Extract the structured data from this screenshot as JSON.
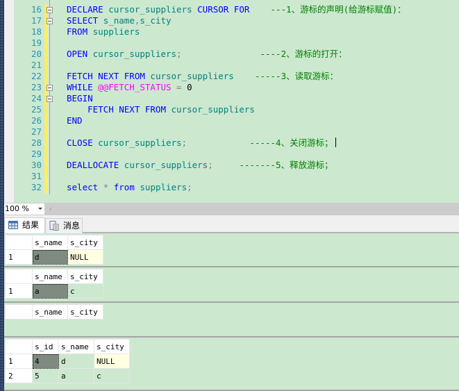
{
  "editor": {
    "lines": [
      {
        "num": "16",
        "fold": true,
        "segments": [
          [
            "kw",
            "DECLARE "
          ],
          [
            "id",
            "cursor_suppliers "
          ],
          [
            "kw",
            "CURSOR FOR"
          ],
          [
            "cm",
            "    ---1、游标的声明(给游标赋值)："
          ]
        ]
      },
      {
        "num": "17",
        "fold": true,
        "segments": [
          [
            "kw",
            "SELECT "
          ],
          [
            "id",
            "s_name"
          ],
          [
            "op",
            ","
          ],
          [
            "id",
            "s_city"
          ]
        ]
      },
      {
        "num": "18",
        "fold": false,
        "segments": [
          [
            "kw",
            "FROM "
          ],
          [
            "id",
            "suppliers"
          ]
        ]
      },
      {
        "num": "19",
        "fold": false,
        "segments": []
      },
      {
        "num": "20",
        "fold": false,
        "segments": [
          [
            "kw",
            "OPEN "
          ],
          [
            "id",
            "cursor_suppliers"
          ],
          [
            "op",
            ";"
          ],
          [
            "cm",
            "               ----2、游标的打开："
          ]
        ]
      },
      {
        "num": "21",
        "fold": false,
        "segments": []
      },
      {
        "num": "22",
        "fold": false,
        "segments": [
          [
            "kw",
            "FETCH NEXT FROM "
          ],
          [
            "id",
            "cursor_suppliers"
          ],
          [
            "cm",
            "    -----3、读取游标："
          ]
        ]
      },
      {
        "num": "23",
        "fold": true,
        "segments": [
          [
            "kw",
            "WHILE "
          ],
          [
            "sys",
            "@@FETCH_STATUS"
          ],
          [
            "op",
            " = "
          ],
          [
            "num",
            "0"
          ]
        ]
      },
      {
        "num": "24",
        "fold": true,
        "segments": [
          [
            "kw",
            "BEGIN"
          ]
        ]
      },
      {
        "num": "25",
        "fold": false,
        "segments": [
          [
            "kw",
            "    FETCH NEXT FROM "
          ],
          [
            "id",
            "cursor_suppliers"
          ]
        ]
      },
      {
        "num": "26",
        "fold": false,
        "segments": [
          [
            "kw",
            "END"
          ]
        ]
      },
      {
        "num": "27",
        "fold": false,
        "segments": []
      },
      {
        "num": "28",
        "fold": false,
        "caret": true,
        "segments": [
          [
            "kw",
            "CLOSE "
          ],
          [
            "id",
            "cursor_suppliers"
          ],
          [
            "op",
            ";"
          ],
          [
            "cm",
            "            -----4、关闭游标；"
          ]
        ]
      },
      {
        "num": "29",
        "fold": false,
        "segments": []
      },
      {
        "num": "30",
        "fold": false,
        "segments": [
          [
            "kw",
            "DEALLOCATE "
          ],
          [
            "id",
            "cursor_suppliers"
          ],
          [
            "op",
            ";"
          ],
          [
            "cm",
            "     -------5、释放游标；"
          ]
        ]
      },
      {
        "num": "31",
        "fold": false,
        "segments": []
      },
      {
        "num": "32",
        "fold": false,
        "segments": [
          [
            "kw",
            "select "
          ],
          [
            "op",
            "* "
          ],
          [
            "kw",
            "from "
          ],
          [
            "id",
            "suppliers"
          ],
          [
            "op",
            ";"
          ]
        ]
      }
    ]
  },
  "statusbar": {
    "zoom_value": "100 %",
    "scroll_left_glyph": "‹"
  },
  "tabs": [
    {
      "label": "结果",
      "icon": "grid-icon",
      "active": true
    },
    {
      "label": "消息",
      "icon": "messages-icon",
      "active": false
    }
  ],
  "results": [
    {
      "columns": [
        "s_name",
        "s_city"
      ],
      "rows": [
        {
          "rownum": "1",
          "cells": [
            "d",
            "NULL"
          ]
        }
      ]
    },
    {
      "columns": [
        "s_name",
        "s_city"
      ],
      "rows": [
        {
          "rownum": "1",
          "cells": [
            "a",
            "c"
          ]
        }
      ]
    },
    {
      "columns": [
        "s_name",
        "s_city"
      ],
      "rows": []
    },
    {
      "columns": [
        "s_id",
        "s_name",
        "s_city"
      ],
      "rows": [
        {
          "rownum": "1",
          "cells": [
            "4",
            "d",
            "NULL"
          ]
        },
        {
          "rownum": "2",
          "cells": [
            "5",
            "a",
            "c"
          ]
        }
      ]
    }
  ]
}
